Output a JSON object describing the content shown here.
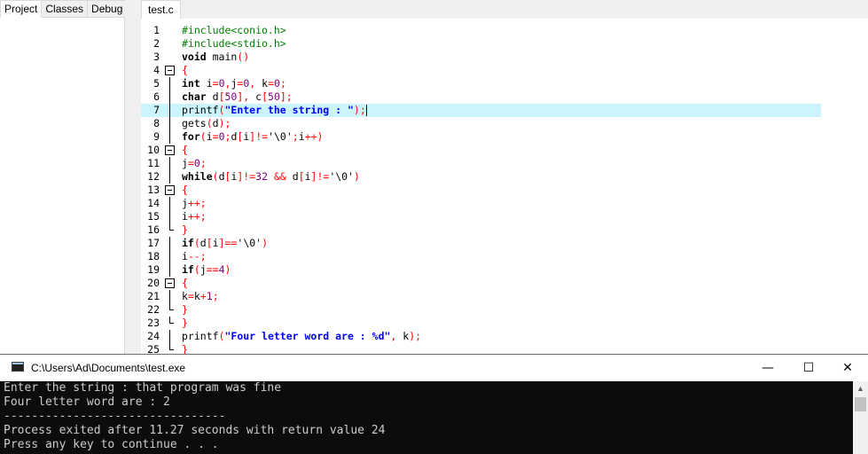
{
  "left_panel": {
    "tabs": [
      "Project",
      "Classes",
      "Debug"
    ]
  },
  "editor": {
    "file_tab": "test.c",
    "current_line": 7,
    "lines": [
      {
        "n": "1",
        "fold": "",
        "tokens": [
          [
            "pp",
            "#include<conio.h>"
          ]
        ]
      },
      {
        "n": "2",
        "fold": "",
        "tokens": [
          [
            "pp",
            "#include<stdio.h>"
          ]
        ]
      },
      {
        "n": "3",
        "fold": "",
        "tokens": [
          [
            "kw",
            "void"
          ],
          [
            "txt",
            " main"
          ],
          [
            "sym",
            "()"
          ]
        ]
      },
      {
        "n": "4",
        "fold": "open",
        "tokens": [
          [
            "sym",
            "{"
          ]
        ]
      },
      {
        "n": "5",
        "fold": "line",
        "tokens": [
          [
            "kw",
            "int"
          ],
          [
            "txt",
            " i"
          ],
          [
            "sym",
            "="
          ],
          [
            "num",
            "0"
          ],
          [
            "sym",
            ","
          ],
          [
            "txt",
            "j"
          ],
          [
            "sym",
            "="
          ],
          [
            "num",
            "0"
          ],
          [
            "sym",
            ","
          ],
          [
            "txt",
            " k"
          ],
          [
            "sym",
            "="
          ],
          [
            "num",
            "0"
          ],
          [
            "sym",
            ";"
          ]
        ]
      },
      {
        "n": "6",
        "fold": "line",
        "tokens": [
          [
            "kw",
            "char"
          ],
          [
            "txt",
            " d"
          ],
          [
            "sym",
            "["
          ],
          [
            "num",
            "50"
          ],
          [
            "sym",
            "],"
          ],
          [
            "txt",
            " c"
          ],
          [
            "sym",
            "["
          ],
          [
            "num",
            "50"
          ],
          [
            "sym",
            "];"
          ]
        ]
      },
      {
        "n": "7",
        "fold": "line",
        "tokens": [
          [
            "txt",
            "printf"
          ],
          [
            "sym",
            "("
          ],
          [
            "str",
            "\"Enter the string : \""
          ],
          [
            "sym",
            ");"
          ]
        ]
      },
      {
        "n": "8",
        "fold": "line",
        "tokens": [
          [
            "txt",
            "gets"
          ],
          [
            "sym",
            "("
          ],
          [
            "txt",
            "d"
          ],
          [
            "sym",
            ");"
          ]
        ]
      },
      {
        "n": "9",
        "fold": "line",
        "tokens": [
          [
            "kw",
            "for"
          ],
          [
            "sym",
            "("
          ],
          [
            "txt",
            "i"
          ],
          [
            "sym",
            "="
          ],
          [
            "num",
            "0"
          ],
          [
            "sym",
            ";"
          ],
          [
            "txt",
            "d"
          ],
          [
            "sym",
            "["
          ],
          [
            "txt",
            "i"
          ],
          [
            "sym",
            "]!="
          ],
          [
            "txt",
            "'\\0'"
          ],
          [
            "sym",
            ";"
          ],
          [
            "txt",
            "i"
          ],
          [
            "sym",
            "++)"
          ]
        ]
      },
      {
        "n": "10",
        "fold": "open",
        "tokens": [
          [
            "sym",
            "{"
          ]
        ]
      },
      {
        "n": "11",
        "fold": "line",
        "tokens": [
          [
            "txt",
            "j"
          ],
          [
            "sym",
            "="
          ],
          [
            "num",
            "0"
          ],
          [
            "sym",
            ";"
          ]
        ]
      },
      {
        "n": "12",
        "fold": "line",
        "tokens": [
          [
            "kw",
            "while"
          ],
          [
            "sym",
            "("
          ],
          [
            "txt",
            "d"
          ],
          [
            "sym",
            "["
          ],
          [
            "txt",
            "i"
          ],
          [
            "sym",
            "]!="
          ],
          [
            "num",
            "32"
          ],
          [
            "sym",
            " && "
          ],
          [
            "txt",
            "d"
          ],
          [
            "sym",
            "["
          ],
          [
            "txt",
            "i"
          ],
          [
            "sym",
            "]!="
          ],
          [
            "txt",
            "'\\0'"
          ],
          [
            "sym",
            ")"
          ]
        ]
      },
      {
        "n": "13",
        "fold": "open",
        "tokens": [
          [
            "sym",
            "{"
          ]
        ]
      },
      {
        "n": "14",
        "fold": "line",
        "tokens": [
          [
            "txt",
            "j"
          ],
          [
            "sym",
            "++;"
          ]
        ]
      },
      {
        "n": "15",
        "fold": "line",
        "tokens": [
          [
            "txt",
            "i"
          ],
          [
            "sym",
            "++;"
          ]
        ]
      },
      {
        "n": "16",
        "fold": "end",
        "tokens": [
          [
            "sym",
            "}"
          ]
        ]
      },
      {
        "n": "17",
        "fold": "line",
        "tokens": [
          [
            "kw",
            "if"
          ],
          [
            "sym",
            "("
          ],
          [
            "txt",
            "d"
          ],
          [
            "sym",
            "["
          ],
          [
            "txt",
            "i"
          ],
          [
            "sym",
            "]=="
          ],
          [
            "txt",
            "'\\0'"
          ],
          [
            "sym",
            ")"
          ]
        ]
      },
      {
        "n": "18",
        "fold": "line",
        "tokens": [
          [
            "txt",
            "i"
          ],
          [
            "sym",
            "--;"
          ]
        ]
      },
      {
        "n": "19",
        "fold": "line",
        "tokens": [
          [
            "kw",
            "if"
          ],
          [
            "sym",
            "("
          ],
          [
            "txt",
            "j"
          ],
          [
            "sym",
            "=="
          ],
          [
            "num",
            "4"
          ],
          [
            "sym",
            ")"
          ]
        ]
      },
      {
        "n": "20",
        "fold": "open",
        "tokens": [
          [
            "sym",
            "{"
          ]
        ]
      },
      {
        "n": "21",
        "fold": "line",
        "tokens": [
          [
            "txt",
            "k"
          ],
          [
            "sym",
            "="
          ],
          [
            "txt",
            "k"
          ],
          [
            "sym",
            "+"
          ],
          [
            "num",
            "1"
          ],
          [
            "sym",
            ";"
          ]
        ]
      },
      {
        "n": "22",
        "fold": "end",
        "tokens": [
          [
            "sym",
            "}"
          ]
        ]
      },
      {
        "n": "23",
        "fold": "end",
        "tokens": [
          [
            "sym",
            "}"
          ]
        ]
      },
      {
        "n": "24",
        "fold": "line",
        "tokens": [
          [
            "txt",
            "printf"
          ],
          [
            "sym",
            "("
          ],
          [
            "str",
            "\"Four letter word are : %d\""
          ],
          [
            "sym",
            ","
          ],
          [
            "txt",
            " k"
          ],
          [
            "sym",
            ");"
          ]
        ]
      },
      {
        "n": "25",
        "fold": "end",
        "tokens": [
          [
            "sym",
            "}"
          ]
        ]
      }
    ]
  },
  "console": {
    "title": "C:\\Users\\Ad\\Documents\\test.exe",
    "minimize_label": "—",
    "maximize_label": "☐",
    "close_label": "✕",
    "scroll_up_label": "▲",
    "lines": [
      "Enter the string : that program was fine",
      "Four letter word are : 2",
      "--------------------------------",
      "Process exited after 11.27 seconds with return value 24",
      "Press any key to continue . . ."
    ]
  },
  "colors": {
    "keyword": "#000000",
    "preprocessor": "#008000",
    "number": "#800080",
    "string": "#0000ff",
    "symbol": "#ff0000",
    "current_line": "#ccf4fc",
    "console_bg": "#0c0c0c",
    "console_text": "#cccccc"
  }
}
